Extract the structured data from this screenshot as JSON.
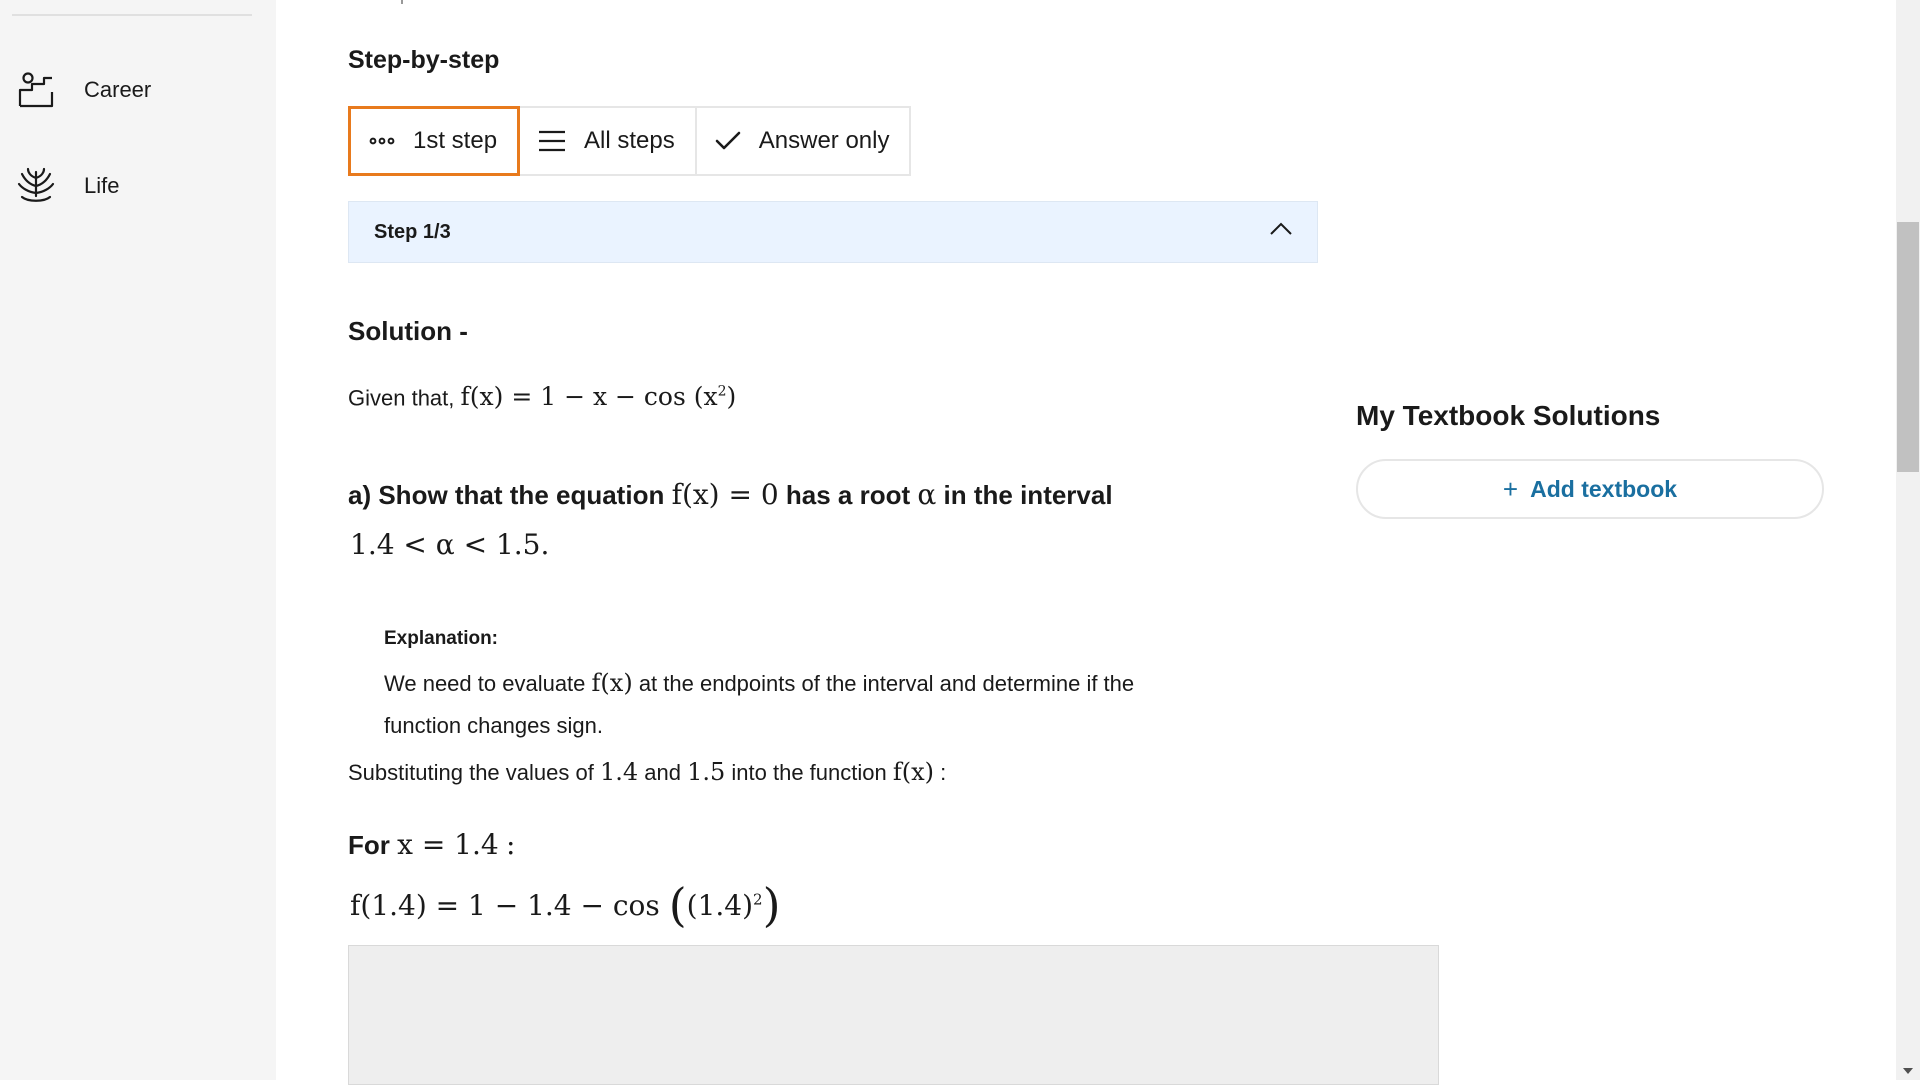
{
  "sidebar": {
    "items": [
      {
        "label": "Career",
        "icon": "career-icon"
      },
      {
        "label": "Life",
        "icon": "life-icon"
      }
    ]
  },
  "content": {
    "section_title": "Step-by-step",
    "view_toggle": {
      "first_step": "1st step",
      "all_steps": "All steps",
      "answer_only": "Answer only"
    },
    "step_header": "Step 1/3",
    "solution_heading": "Solution -",
    "given_prefix": "Given that,",
    "given_math_a": "f(x) = 1 − x − cos (x",
    "given_math_sup": "2",
    "given_math_b": ")",
    "question_prefix": "a)  Show that the equation",
    "question_math_fx": "f(x) = 0",
    "question_mid": "has a root",
    "question_alpha": "α",
    "question_suffix": "in the interval",
    "question_interval": "1.4 < α < 1.5.",
    "explanation_label": "Explanation:",
    "explanation_pre": "We need to evaluate",
    "explanation_math": "f(x)",
    "explanation_post": "at the endpoints of the interval and determine if the",
    "explanation_line2": "function changes sign.",
    "subst_pre": "Substituting the values of",
    "subst_v1": "1.4",
    "subst_and": "and",
    "subst_v2": "1.5",
    "subst_mid": "into the function",
    "subst_fx": "f(x)",
    "subst_colon": ":",
    "for_label": "For",
    "for_math": "x = 1.4",
    "for_colon": ":",
    "f14_a": "f(1.4) = 1 − 1.4 − cos",
    "f14_open": "(",
    "f14_inner": "(1.4)",
    "f14_sup": "2",
    "f14_close": ")"
  },
  "right_panel": {
    "title": "My Textbook Solutions",
    "add_button": "Add textbook",
    "add_icon": "plus-icon"
  },
  "colors": {
    "active_border": "#e87a1d",
    "step_bar_bg": "#eaf3ff",
    "link_blue": "#1a6fa0"
  }
}
